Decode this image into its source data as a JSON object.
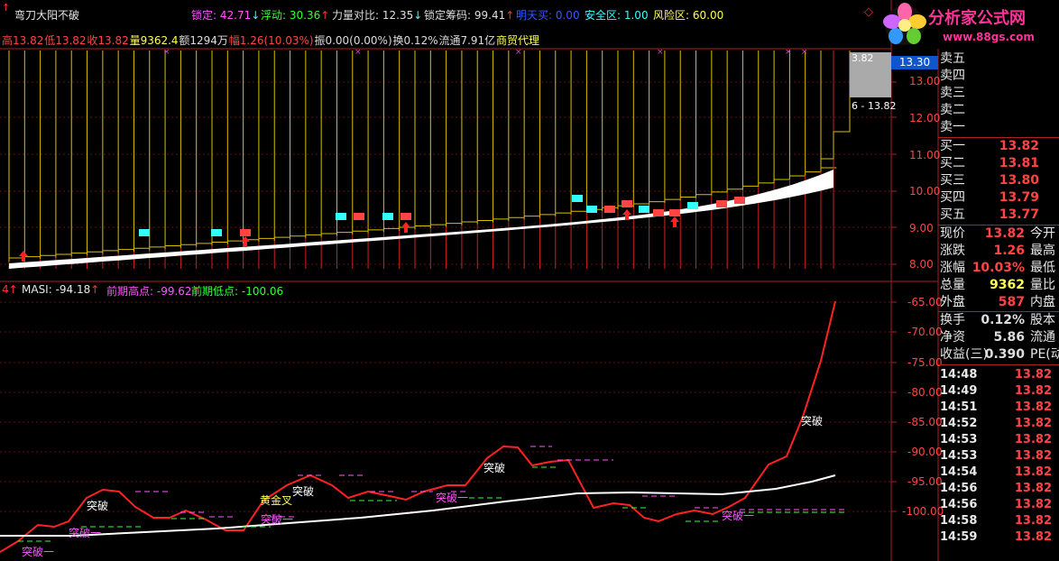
{
  "header": {
    "row1": [
      {
        "text": "弯刀大阳不破",
        "color": "#e8e8e8"
      },
      {
        "text": "锁定: 42.71",
        "color": "#ff55ff"
      },
      {
        "text": "浮动: 30.36",
        "color": "#33ff33"
      },
      {
        "text": "力量对比: 12.35",
        "color": "#dddddd"
      },
      {
        "text": "锁定筹码: 99.41",
        "color": "#dddddd"
      },
      {
        "text": "明天买: 0.00",
        "color": "#3355ff"
      },
      {
        "text": "安全区: 1.00",
        "color": "#33ffff"
      },
      {
        "text": "风险区: 60.00",
        "color": "#ffff55"
      }
    ],
    "row2": [
      {
        "text": "高13.82",
        "color": "#ff4444"
      },
      {
        "text": "低13.82",
        "color": "#ff4444"
      },
      {
        "text": "收13.82",
        "color": "#ff4444"
      },
      {
        "text": "量9362.4",
        "color": "#ffff55"
      },
      {
        "text": "额1294万",
        "color": "#dddddd"
      },
      {
        "text": "幅1.26(10.03%)",
        "color": "#ff4444"
      },
      {
        "text": "振0.00(0.00%)",
        "color": "#dddddd"
      },
      {
        "text": "换0.12%",
        "color": "#dddddd"
      },
      {
        "text": "流通7.91亿",
        "color": "#dddddd"
      },
      {
        "text": "商贸代理",
        "color": "#ffff55"
      }
    ]
  },
  "logo": {
    "title": "分析家公式网",
    "url": "www.88gs.com"
  },
  "price_axis": {
    "labels": [
      "13.00",
      "12.00",
      "11.00",
      "10.00",
      "9.00",
      "8.00"
    ],
    "current": "13.30",
    "tip_top": "3.82",
    "tip_mid": "6 - 13.82"
  },
  "indicator": {
    "masi_label": "MASI: -94.18",
    "prev_high_label": "前期高点: -99.62",
    "prev_low_label": "前期低点: -100.06",
    "axis_labels": [
      "-65.00",
      "-70.00",
      "-75.00",
      "-80.00",
      "-85.00",
      "-90.00",
      "-95.00",
      "-100.00"
    ],
    "annotations": [
      {
        "text": "突破",
        "color": "#ffffff"
      },
      {
        "text": "突破一",
        "color": "#ff55ff"
      },
      {
        "text": "突破一",
        "color": "#ff55ff"
      },
      {
        "text": "黄金叉",
        "color": "#ffff55"
      },
      {
        "text": "突破",
        "color": "#ffffff"
      },
      {
        "text": "突破一",
        "color": "#ff55ff"
      },
      {
        "text": "突破一",
        "color": "#ff55ff"
      },
      {
        "text": "突破",
        "color": "#ffffff"
      },
      {
        "text": "突破一",
        "color": "#ff55ff"
      },
      {
        "text": "突破",
        "color": "#ffffff"
      }
    ]
  },
  "quote_panel": {
    "asks": [
      {
        "label": "卖五"
      },
      {
        "label": "卖四"
      },
      {
        "label": "卖三"
      },
      {
        "label": "卖二"
      },
      {
        "label": "卖一"
      }
    ],
    "bids": [
      {
        "label": "买一",
        "value": "13.82"
      },
      {
        "label": "买二",
        "value": "13.81"
      },
      {
        "label": "买三",
        "value": "13.80"
      },
      {
        "label": "买四",
        "value": "13.79"
      },
      {
        "label": "买五",
        "value": "13.77"
      }
    ],
    "stats": [
      {
        "label": "现价",
        "value": "13.82",
        "color": "#ff4444",
        "extra": "今开"
      },
      {
        "label": "涨跌",
        "value": "1.26",
        "color": "#ff4444",
        "extra": "最高"
      },
      {
        "label": "涨幅",
        "value": "10.03%",
        "color": "#ff4444",
        "extra": "最低"
      },
      {
        "label": "总量",
        "value": "9362",
        "color": "#ffff55",
        "extra": "量比"
      },
      {
        "label": "外盘",
        "value": "587",
        "color": "#ff4444",
        "extra": "内盘"
      },
      {
        "label": "换手",
        "value": "0.12%",
        "color": "#dddddd",
        "extra": "股本"
      },
      {
        "label": "净资",
        "value": "5.86",
        "color": "#dddddd",
        "extra": "流通"
      },
      {
        "label": "收益(三)",
        "value": "0.390",
        "color": "#dddddd",
        "extra": "PE(动"
      }
    ],
    "ticks": [
      {
        "time": "14:48",
        "price": "13.82"
      },
      {
        "time": "14:49",
        "price": "13.82"
      },
      {
        "time": "14:51",
        "price": "13.82"
      },
      {
        "time": "14:52",
        "price": "13.82"
      },
      {
        "time": "14:53",
        "price": "13.82"
      },
      {
        "time": "14:53",
        "price": "13.82"
      },
      {
        "time": "14:54",
        "price": "13.82"
      },
      {
        "time": "14:56",
        "price": "13.82"
      },
      {
        "time": "14:56",
        "price": "13.82"
      },
      {
        "time": "14:58",
        "price": "13.82"
      },
      {
        "time": "14:59",
        "price": "13.82"
      }
    ]
  }
}
